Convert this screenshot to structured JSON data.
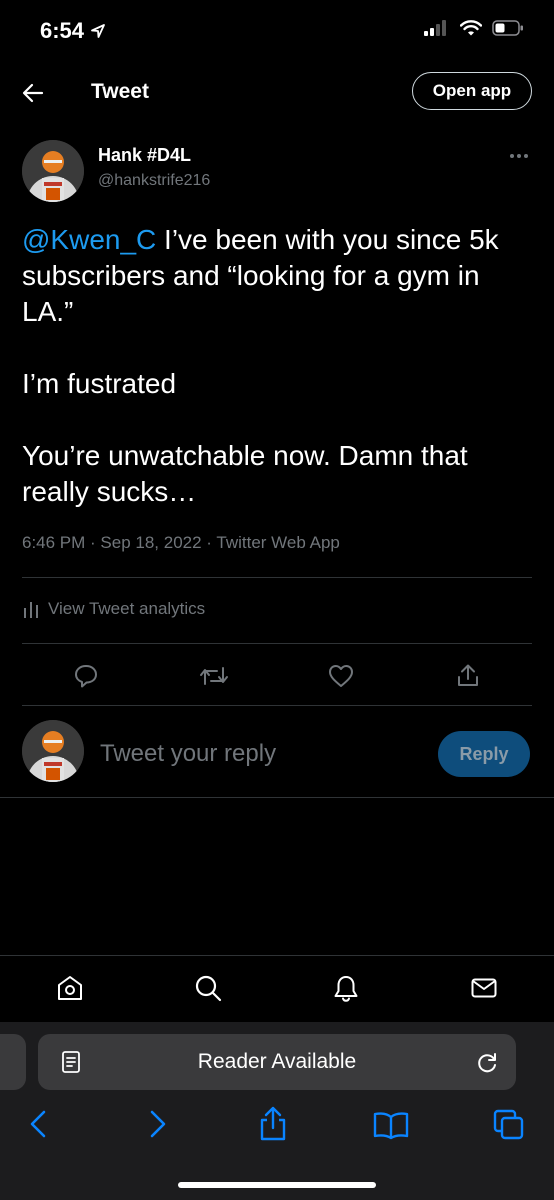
{
  "status_bar": {
    "time": "6:54"
  },
  "header": {
    "title": "Tweet",
    "open_app_label": "Open app"
  },
  "tweet": {
    "author_name": "Hank #D4L",
    "author_handle": "@hankstrife216",
    "mention": "@Kwen_C",
    "text_line1_rest": " I’ve been with you since 5k subscribers and “looking for a gym in LA.”",
    "text_para2": "I’m fustrated",
    "text_para3": "You’re unwatchable now. Damn that really sucks…",
    "time": "6:46 PM",
    "date": "Sep 18, 2022",
    "source": "Twitter Web App",
    "separator": " · "
  },
  "analytics": {
    "label": "View Tweet analytics"
  },
  "reply": {
    "placeholder": "Tweet your reply",
    "button_label": "Reply"
  },
  "safari": {
    "address_label": "Reader Available"
  },
  "colors": {
    "accent": "#1d9bf0",
    "reply_button": "#0e4d7c",
    "muted": "#71767b",
    "safari_blue": "#0a84ff"
  }
}
